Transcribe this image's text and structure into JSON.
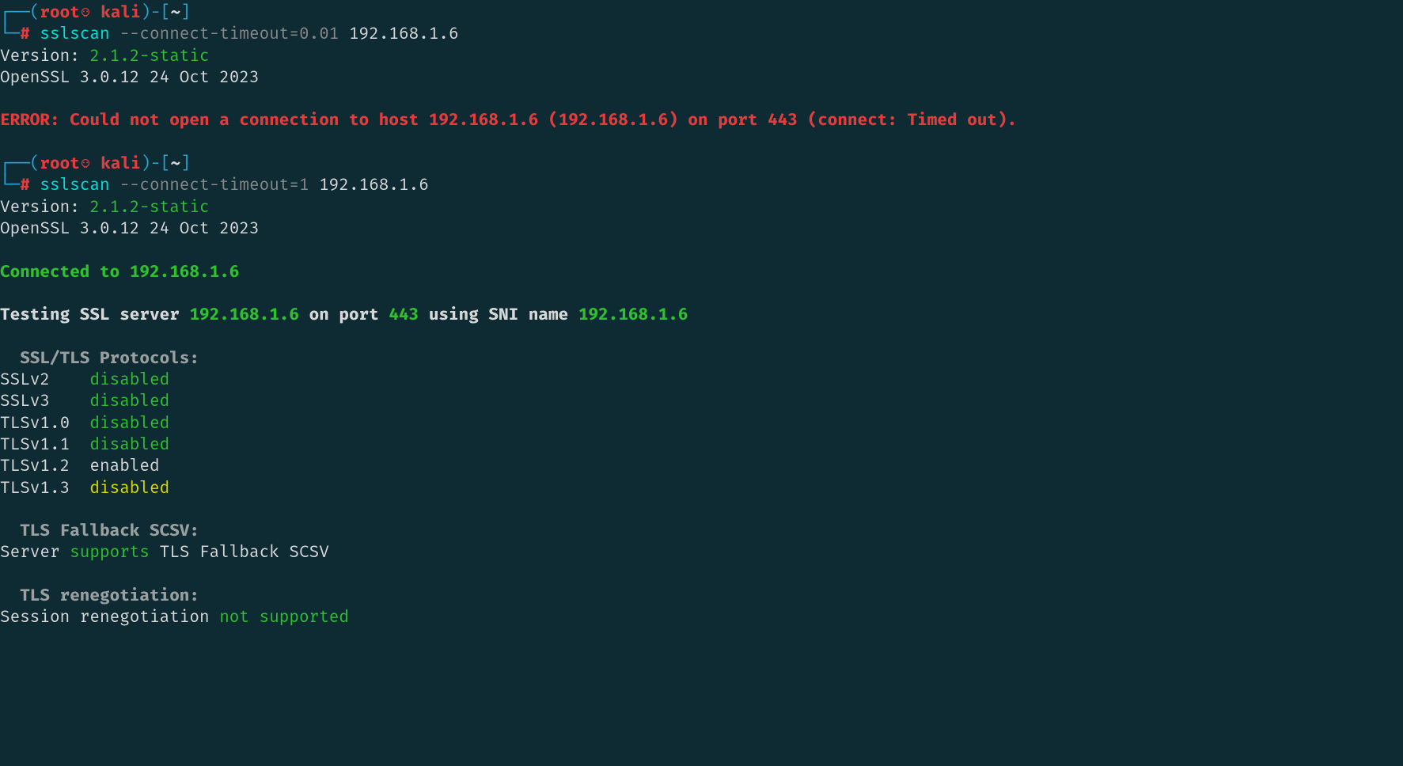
{
  "prompt1": {
    "corner_top": "┌──(",
    "user": "root",
    "skull": "💀",
    "host": "kali",
    "after_host": ")-[",
    "path": "~",
    "close": "]",
    "corner_bot": "└─",
    "hash": "#",
    "cmd_name": "sslscan",
    "cmd_args": " --connect-timeout=0.01",
    "cmd_target": " 192.168.1.6"
  },
  "out1": {
    "version_label": "Version: ",
    "version_val": "2.1.2-static",
    "openssl": "OpenSSL 3.0.12 24 Oct 2023",
    "error": "ERROR: Could not open a connection to host 192.168.1.6 (192.168.1.6) on port 443 (connect: Timed out)."
  },
  "prompt2": {
    "corner_top": "┌──(",
    "user": "root",
    "skull": "💀",
    "host": "kali",
    "after_host": ")-[",
    "path": "~",
    "close": "]",
    "corner_bot": "└─",
    "hash": "#",
    "cmd_name": "sslscan",
    "cmd_args": " --connect-timeout=1",
    "cmd_target": " 192.168.1.6"
  },
  "out2": {
    "version_label": "Version: ",
    "version_val": "2.1.2-static",
    "openssl": "OpenSSL 3.0.12 24 Oct 2023",
    "connected": "Connected to 192.168.1.6",
    "testing_pre": "Testing SSL server ",
    "testing_host": "192.168.1.6",
    "testing_mid": " on port ",
    "testing_port": "443",
    "testing_mid2": " using SNI name ",
    "testing_sni": "192.168.1.6",
    "proto_hdr": "  SSL/TLS Protocols:",
    "protocols": [
      {
        "name": "SSLv2    ",
        "status": "disabled",
        "cls": "green"
      },
      {
        "name": "SSLv3    ",
        "status": "disabled",
        "cls": "green"
      },
      {
        "name": "TLSv1.0  ",
        "status": "disabled",
        "cls": "green"
      },
      {
        "name": "TLSv1.1  ",
        "status": "disabled",
        "cls": "green"
      },
      {
        "name": "TLSv1.2  ",
        "status": "enabled",
        "cls": "white"
      },
      {
        "name": "TLSv1.3  ",
        "status": "disabled",
        "cls": "yellow"
      }
    ],
    "fallback_hdr": "  TLS Fallback SCSV:",
    "fallback_pre": "Server ",
    "fallback_word": "supports",
    "fallback_post": " TLS Fallback SCSV",
    "reneg_hdr": "  TLS renegotiation:",
    "reneg_pre": "Session renegotiation ",
    "reneg_word": "not supported"
  }
}
